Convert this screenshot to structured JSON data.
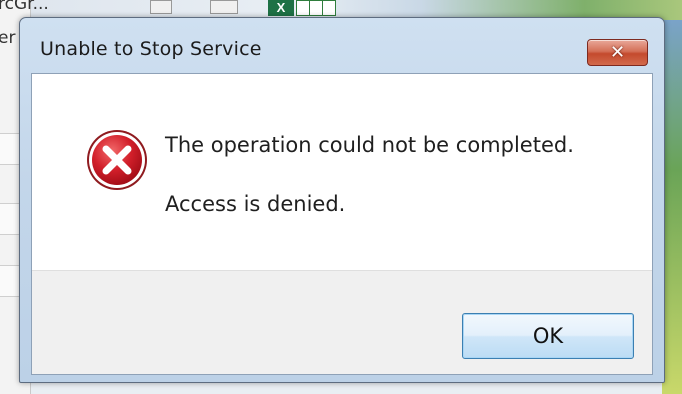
{
  "background": {
    "left_text_1": "rcGr...",
    "left_text_2": "er",
    "excel_glyph": "X"
  },
  "dialog": {
    "title": "Unable to Stop Service",
    "close_glyph": "✕",
    "icon": "error-icon",
    "message_primary": "The operation could not be completed.",
    "message_secondary": "Access is denied.",
    "ok_label": "OK"
  },
  "colors": {
    "error_red": "#c8102e",
    "close_button_red": "#c44a2e",
    "button_border_blue": "#3c7fb1"
  }
}
